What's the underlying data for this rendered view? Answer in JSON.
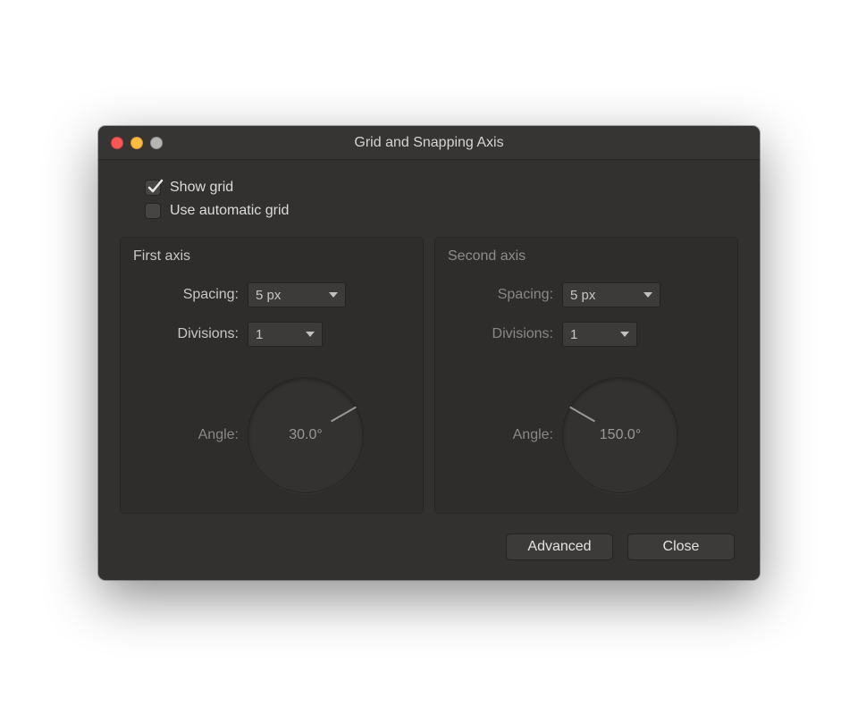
{
  "window": {
    "title": "Grid and Snapping Axis"
  },
  "checkboxes": {
    "show_grid": {
      "label": "Show grid",
      "checked": true
    },
    "auto_grid": {
      "label": "Use automatic grid",
      "checked": false
    }
  },
  "axes": {
    "first": {
      "title": "First axis",
      "spacing_label": "Spacing:",
      "spacing_value": "5 px",
      "divisions_label": "Divisions:",
      "divisions_value": "1",
      "angle_label": "Angle:",
      "angle_value": "30.0°",
      "angle_deg": 30.0
    },
    "second": {
      "title": "Second axis",
      "spacing_label": "Spacing:",
      "spacing_value": "5 px",
      "divisions_label": "Divisions:",
      "divisions_value": "1",
      "angle_label": "Angle:",
      "angle_value": "150.0°",
      "angle_deg": 150.0
    }
  },
  "buttons": {
    "advanced": "Advanced",
    "close": "Close"
  }
}
